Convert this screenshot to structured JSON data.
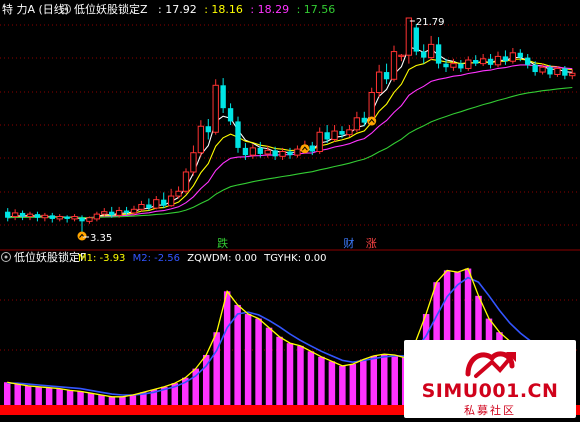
{
  "top_panel": {
    "title": "特 力A (日线)",
    "indicator_name": "低位妖股锁定Z",
    "values": [
      {
        "text": ": 17.92",
        "color": "#ffffff"
      },
      {
        "text": ": 18.16",
        "color": "#ffff00"
      },
      {
        "text": ": 18.29",
        "color": "#ff33ff"
      },
      {
        "text": ": 17.56",
        "color": "#33cc33"
      }
    ],
    "max_label": "21.79",
    "min_label": "3.35",
    "signals": [
      {
        "text": "跌",
        "color": "#33cc33",
        "idx": 29
      },
      {
        "text": "财",
        "color": "#3d7cff",
        "idx": 46
      },
      {
        "text": "涨",
        "color": "#ff4444",
        "idx": 49
      }
    ]
  },
  "bottom_panel": {
    "indicator_name": "低位妖股锁定F",
    "values": [
      {
        "text": "M1: -3.93",
        "color": "#ffff00"
      },
      {
        "text": "M2: -2.56",
        "color": "#3355ff"
      },
      {
        "text": "ZQWDM: 0.00",
        "color": "#ffffff"
      },
      {
        "text": "TGYHK: 0.00",
        "color": "#ffffff"
      }
    ]
  },
  "watermark": {
    "brand": "SIMU001.CN",
    "sub": "私募社区"
  },
  "colors": {
    "up": "#ff3333",
    "down": "#00e5e5",
    "ma_white": "#ffffff",
    "ma_yellow": "#ffff00",
    "ma_magenta": "#ff33ff",
    "ma_green": "#33cc33",
    "bar_magenta": "#ff33ff",
    "bar_red": "#ff0000",
    "line_yellow": "#ffff00",
    "line_blue": "#3355ff",
    "grid": "#8b0000"
  },
  "chart_data": [
    {
      "type": "candlestick",
      "title": "特 力A (日线)",
      "y_labels_shown": [
        "21.79",
        "3.35"
      ],
      "candles": [
        {
          "o": 5.7,
          "c": 5.2,
          "h": 6.0,
          "l": 4.9
        },
        {
          "o": 5.3,
          "c": 5.6,
          "h": 5.9,
          "l": 5.0
        },
        {
          "o": 5.6,
          "c": 5.3,
          "h": 5.8,
          "l": 5.0
        },
        {
          "o": 5.3,
          "c": 5.5,
          "h": 5.7,
          "l": 5.0
        },
        {
          "o": 5.5,
          "c": 5.2,
          "h": 5.7,
          "l": 4.9
        },
        {
          "o": 5.2,
          "c": 5.4,
          "h": 5.6,
          "l": 4.9
        },
        {
          "o": 5.4,
          "c": 5.1,
          "h": 5.6,
          "l": 4.8
        },
        {
          "o": 5.1,
          "c": 5.3,
          "h": 5.5,
          "l": 4.9
        },
        {
          "o": 5.3,
          "c": 5.1,
          "h": 5.4,
          "l": 4.8
        },
        {
          "o": 5.1,
          "c": 5.3,
          "h": 5.5,
          "l": 4.9
        },
        {
          "o": 5.2,
          "c": 4.9,
          "h": 5.4,
          "l": 3.35
        },
        {
          "o": 4.9,
          "c": 5.2,
          "h": 5.3,
          "l": 4.7
        },
        {
          "o": 5.1,
          "c": 5.5,
          "h": 5.7,
          "l": 4.9
        },
        {
          "o": 5.5,
          "c": 5.7,
          "h": 6.0,
          "l": 5.3
        },
        {
          "o": 5.7,
          "c": 5.4,
          "h": 6.1,
          "l": 5.2
        },
        {
          "o": 5.4,
          "c": 5.8,
          "h": 6.1,
          "l": 5.2
        },
        {
          "o": 5.8,
          "c": 5.6,
          "h": 6.1,
          "l": 5.4
        },
        {
          "o": 5.6,
          "c": 5.9,
          "h": 6.2,
          "l": 5.4
        },
        {
          "o": 5.9,
          "c": 6.3,
          "h": 6.6,
          "l": 5.7
        },
        {
          "o": 6.3,
          "c": 6.0,
          "h": 6.8,
          "l": 5.8
        },
        {
          "o": 6.0,
          "c": 6.7,
          "h": 7.0,
          "l": 5.9
        },
        {
          "o": 6.7,
          "c": 6.2,
          "h": 7.3,
          "l": 6.0
        },
        {
          "o": 6.2,
          "c": 7.0,
          "h": 7.6,
          "l": 6.1
        },
        {
          "o": 7.0,
          "c": 7.4,
          "h": 7.8,
          "l": 6.8
        },
        {
          "o": 7.4,
          "c": 9.0,
          "h": 9.3,
          "l": 7.2
        },
        {
          "o": 9.0,
          "c": 10.6,
          "h": 11.2,
          "l": 8.7
        },
        {
          "o": 10.6,
          "c": 12.8,
          "h": 13.3,
          "l": 10.3
        },
        {
          "o": 12.8,
          "c": 12.3,
          "h": 13.4,
          "l": 11.7
        },
        {
          "o": 12.3,
          "c": 16.2,
          "h": 16.7,
          "l": 12.1
        },
        {
          "o": 16.2,
          "c": 14.3,
          "h": 16.8,
          "l": 13.9
        },
        {
          "o": 14.3,
          "c": 13.2,
          "h": 14.7,
          "l": 12.9
        },
        {
          "o": 13.2,
          "c": 11.0,
          "h": 13.6,
          "l": 10.6
        },
        {
          "o": 11.0,
          "c": 10.4,
          "h": 11.4,
          "l": 10.0
        },
        {
          "o": 10.4,
          "c": 11.0,
          "h": 11.3,
          "l": 10.1
        },
        {
          "o": 11.0,
          "c": 10.5,
          "h": 11.5,
          "l": 10.2
        },
        {
          "o": 10.5,
          "c": 10.8,
          "h": 11.2,
          "l": 10.2
        },
        {
          "o": 10.8,
          "c": 10.3,
          "h": 11.1,
          "l": 10.0
        },
        {
          "o": 10.3,
          "c": 10.7,
          "h": 11.0,
          "l": 10.0
        },
        {
          "o": 10.7,
          "c": 10.4,
          "h": 11.0,
          "l": 10.1
        },
        {
          "o": 10.4,
          "c": 10.9,
          "h": 11.2,
          "l": 10.2
        },
        {
          "o": 10.9,
          "c": 11.2,
          "h": 11.6,
          "l": 10.6
        },
        {
          "o": 11.2,
          "c": 10.7,
          "h": 11.5,
          "l": 10.4
        },
        {
          "o": 10.7,
          "c": 12.3,
          "h": 12.7,
          "l": 10.5
        },
        {
          "o": 12.3,
          "c": 11.7,
          "h": 12.9,
          "l": 11.4
        },
        {
          "o": 11.7,
          "c": 12.4,
          "h": 12.9,
          "l": 11.5
        },
        {
          "o": 12.4,
          "c": 12.1,
          "h": 12.8,
          "l": 11.8
        },
        {
          "o": 12.1,
          "c": 12.5,
          "h": 12.9,
          "l": 11.9
        },
        {
          "o": 12.5,
          "c": 13.5,
          "h": 14.0,
          "l": 12.3
        },
        {
          "o": 13.5,
          "c": 13.1,
          "h": 14.0,
          "l": 12.8
        },
        {
          "o": 13.1,
          "c": 15.6,
          "h": 16.0,
          "l": 12.9
        },
        {
          "o": 15.6,
          "c": 17.3,
          "h": 17.9,
          "l": 15.2
        },
        {
          "o": 17.3,
          "c": 16.7,
          "h": 18.0,
          "l": 16.3
        },
        {
          "o": 16.7,
          "c": 19.0,
          "h": 19.5,
          "l": 16.5
        },
        {
          "o": 18.6,
          "c": 18.7,
          "h": 18.8,
          "l": 18.2
        },
        {
          "o": 18.7,
          "c": 21.79,
          "h": 21.79,
          "l": 18.0
        },
        {
          "o": 21.0,
          "c": 19.0,
          "h": 21.3,
          "l": 18.7
        },
        {
          "o": 19.0,
          "c": 18.5,
          "h": 19.6,
          "l": 18.0
        },
        {
          "o": 18.5,
          "c": 19.6,
          "h": 20.3,
          "l": 18.3
        },
        {
          "o": 19.6,
          "c": 18.0,
          "h": 20.2,
          "l": 17.6
        },
        {
          "o": 18.0,
          "c": 17.7,
          "h": 18.4,
          "l": 17.3
        },
        {
          "o": 17.7,
          "c": 18.0,
          "h": 18.4,
          "l": 17.4
        },
        {
          "o": 18.0,
          "c": 17.6,
          "h": 18.3,
          "l": 17.3
        },
        {
          "o": 17.6,
          "c": 18.3,
          "h": 18.6,
          "l": 17.4
        },
        {
          "o": 18.3,
          "c": 18.0,
          "h": 18.7,
          "l": 17.8
        },
        {
          "o": 18.0,
          "c": 18.4,
          "h": 18.8,
          "l": 17.8
        },
        {
          "o": 18.4,
          "c": 17.9,
          "h": 18.8,
          "l": 17.6
        },
        {
          "o": 17.9,
          "c": 18.6,
          "h": 19.0,
          "l": 17.7
        },
        {
          "o": 18.6,
          "c": 18.2,
          "h": 19.1,
          "l": 17.9
        },
        {
          "o": 18.2,
          "c": 18.9,
          "h": 19.3,
          "l": 18.0
        },
        {
          "o": 18.9,
          "c": 18.5,
          "h": 19.2,
          "l": 18.2
        },
        {
          "o": 18.5,
          "c": 17.9,
          "h": 18.8,
          "l": 17.6
        },
        {
          "o": 17.9,
          "c": 17.3,
          "h": 18.2,
          "l": 17.0
        },
        {
          "o": 17.3,
          "c": 17.7,
          "h": 18.0,
          "l": 17.1
        },
        {
          "o": 17.7,
          "c": 17.1,
          "h": 17.9,
          "l": 16.8
        },
        {
          "o": 17.1,
          "c": 17.6,
          "h": 17.8,
          "l": 16.9
        },
        {
          "o": 17.6,
          "c": 17.0,
          "h": 17.8,
          "l": 16.7
        },
        {
          "o": 17.0,
          "c": 17.2,
          "h": 17.5,
          "l": 16.7
        }
      ]
    },
    {
      "type": "bar",
      "title": "低位妖股锁定F",
      "series": [
        {
          "name": "M1",
          "values": [
            2.5,
            2.3,
            2.1,
            2.0,
            1.9,
            1.8,
            1.6,
            1.5,
            1.3,
            1.1,
            0.9,
            0.9,
            1.1,
            1.4,
            1.7,
            2.0,
            2.4,
            3.0,
            4.0,
            5.5,
            8.0,
            12.5,
            11.0,
            10.0,
            9.5,
            8.5,
            7.5,
            6.8,
            6.5,
            5.9,
            5.3,
            4.8,
            4.3,
            4.5,
            5.0,
            5.4,
            5.6,
            5.5,
            5.2,
            7.0,
            10.0,
            13.5,
            14.8,
            14.6,
            15.0,
            12.0,
            9.5,
            8.0,
            7.0,
            6.3,
            5.8,
            5.2,
            4.7,
            4.2,
            3.8
          ]
        },
        {
          "name": "M2",
          "values": [
            2.4,
            2.4,
            2.3,
            2.2,
            2.1,
            2.0,
            1.9,
            1.8,
            1.6,
            1.4,
            1.2,
            1.1,
            1.1,
            1.2,
            1.4,
            1.7,
            2.0,
            2.5,
            3.2,
            4.3,
            6.0,
            8.5,
            10.0,
            10.2,
            9.9,
            9.3,
            8.6,
            7.8,
            7.1,
            6.5,
            5.9,
            5.4,
            4.9,
            4.7,
            4.9,
            5.1,
            5.3,
            5.4,
            5.4,
            6.1,
            7.6,
            9.8,
            11.9,
            13.2,
            14.0,
            13.5,
            12.0,
            10.4,
            9.0,
            7.9,
            7.0,
            6.2,
            5.6,
            5.1,
            4.7
          ]
        }
      ]
    }
  ]
}
